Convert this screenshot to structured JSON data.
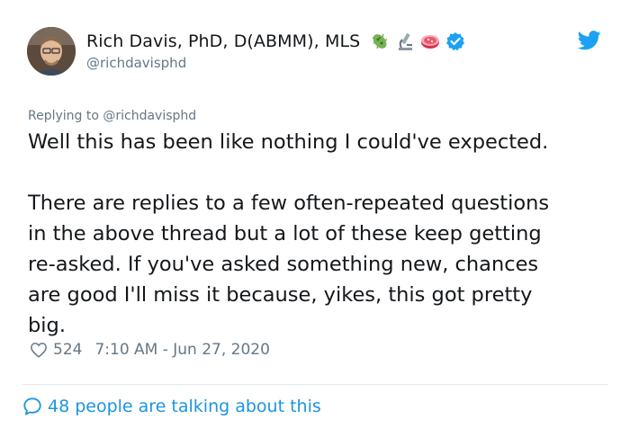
{
  "author": {
    "display_name": "Rich Davis, PhD, D(ABMM), MLS",
    "handle": "@richdavisphd",
    "name_emojis": [
      "microbe-icon",
      "microscope-icon",
      "petri-dish-icon"
    ],
    "verified": true
  },
  "tweet": {
    "reply_context": "Replying to @richdavisphd",
    "paragraph_1": "Well this has been like nothing I could've expected.",
    "paragraph_2_lines": [
      "There are replies to a few often-repeated questions",
      "in the above thread but a lot of these keep getting",
      "re-asked. If you've asked something new, chances",
      "are good I'll miss it because, yikes, this got pretty",
      "big."
    ],
    "like_count": "524",
    "timestamp": "7:10 AM - Jun 27, 2020",
    "conversation_text": "48 people are talking about this"
  },
  "colors": {
    "accent": "#1da1f2",
    "link": "#1b95e0",
    "secondary_text": "#657786",
    "primary_text": "#14171a",
    "divider": "#e1e8ed"
  }
}
